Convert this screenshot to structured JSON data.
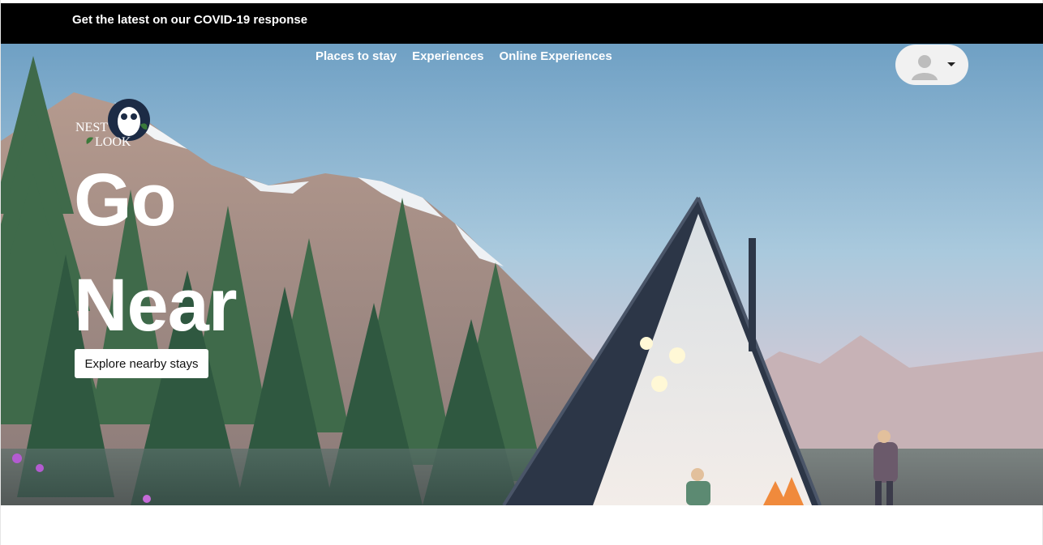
{
  "covid_banner": {
    "link_text": "Get the latest on our COVID-19 response"
  },
  "nav": {
    "items": [
      {
        "label": "Places to stay"
      },
      {
        "label": "Experiences"
      },
      {
        "label": "Online Experiences"
      }
    ]
  },
  "profile": {
    "avatar_icon": "user-silhouette-icon",
    "caret_icon": "caret-down-icon"
  },
  "logo": {
    "text_line1": "NEST",
    "text_line2": "LOOK",
    "icon": "owl-icon"
  },
  "hero": {
    "headline_line1": "Go",
    "headline_line2": "Near",
    "cta_label": "Explore nearby stays",
    "illustration": "a-frame-cabin-mountain-scene"
  },
  "colors": {
    "banner_bg": "#000000",
    "text_light": "#ffffff",
    "button_bg": "#ffffff",
    "profile_bg": "#f1f1f1",
    "logo_circle": "#1c2b45"
  }
}
